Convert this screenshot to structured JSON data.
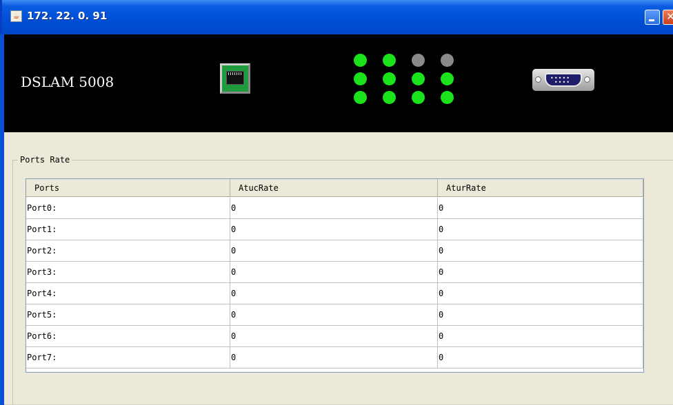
{
  "window": {
    "title": "172. 22. 0. 91"
  },
  "header": {
    "device_name": "DSLAM 5008"
  },
  "leds": [
    [
      "on",
      "on",
      "off",
      "off"
    ],
    [
      "on",
      "on",
      "on",
      "on"
    ],
    [
      "on",
      "on",
      "on",
      "on"
    ]
  ],
  "colors": {
    "led_on": "#1be31b",
    "led_off": "#8a8a8a",
    "title_bar": "#0050d8",
    "header_bg": "#000000"
  },
  "ports_rate": {
    "group_title": "Ports Rate",
    "columns": [
      "Ports",
      "AtucRate",
      "AturRate"
    ],
    "rows": [
      {
        "port": "Port0:",
        "atuc": "0",
        "atur": "0"
      },
      {
        "port": "Port1:",
        "atuc": "0",
        "atur": "0"
      },
      {
        "port": "Port2:",
        "atuc": "0",
        "atur": "0"
      },
      {
        "port": "Port3:",
        "atuc": "0",
        "atur": "0"
      },
      {
        "port": "Port4:",
        "atuc": "0",
        "atur": "0"
      },
      {
        "port": "Port5:",
        "atuc": "0",
        "atur": "0"
      },
      {
        "port": "Port6:",
        "atuc": "0",
        "atur": "0"
      },
      {
        "port": "Port7:",
        "atuc": "0",
        "atur": "0"
      }
    ]
  },
  "icons": {
    "window": "java-cup-icon",
    "ethernet": "ethernet-port-icon",
    "serial": "serial-port-icon"
  }
}
